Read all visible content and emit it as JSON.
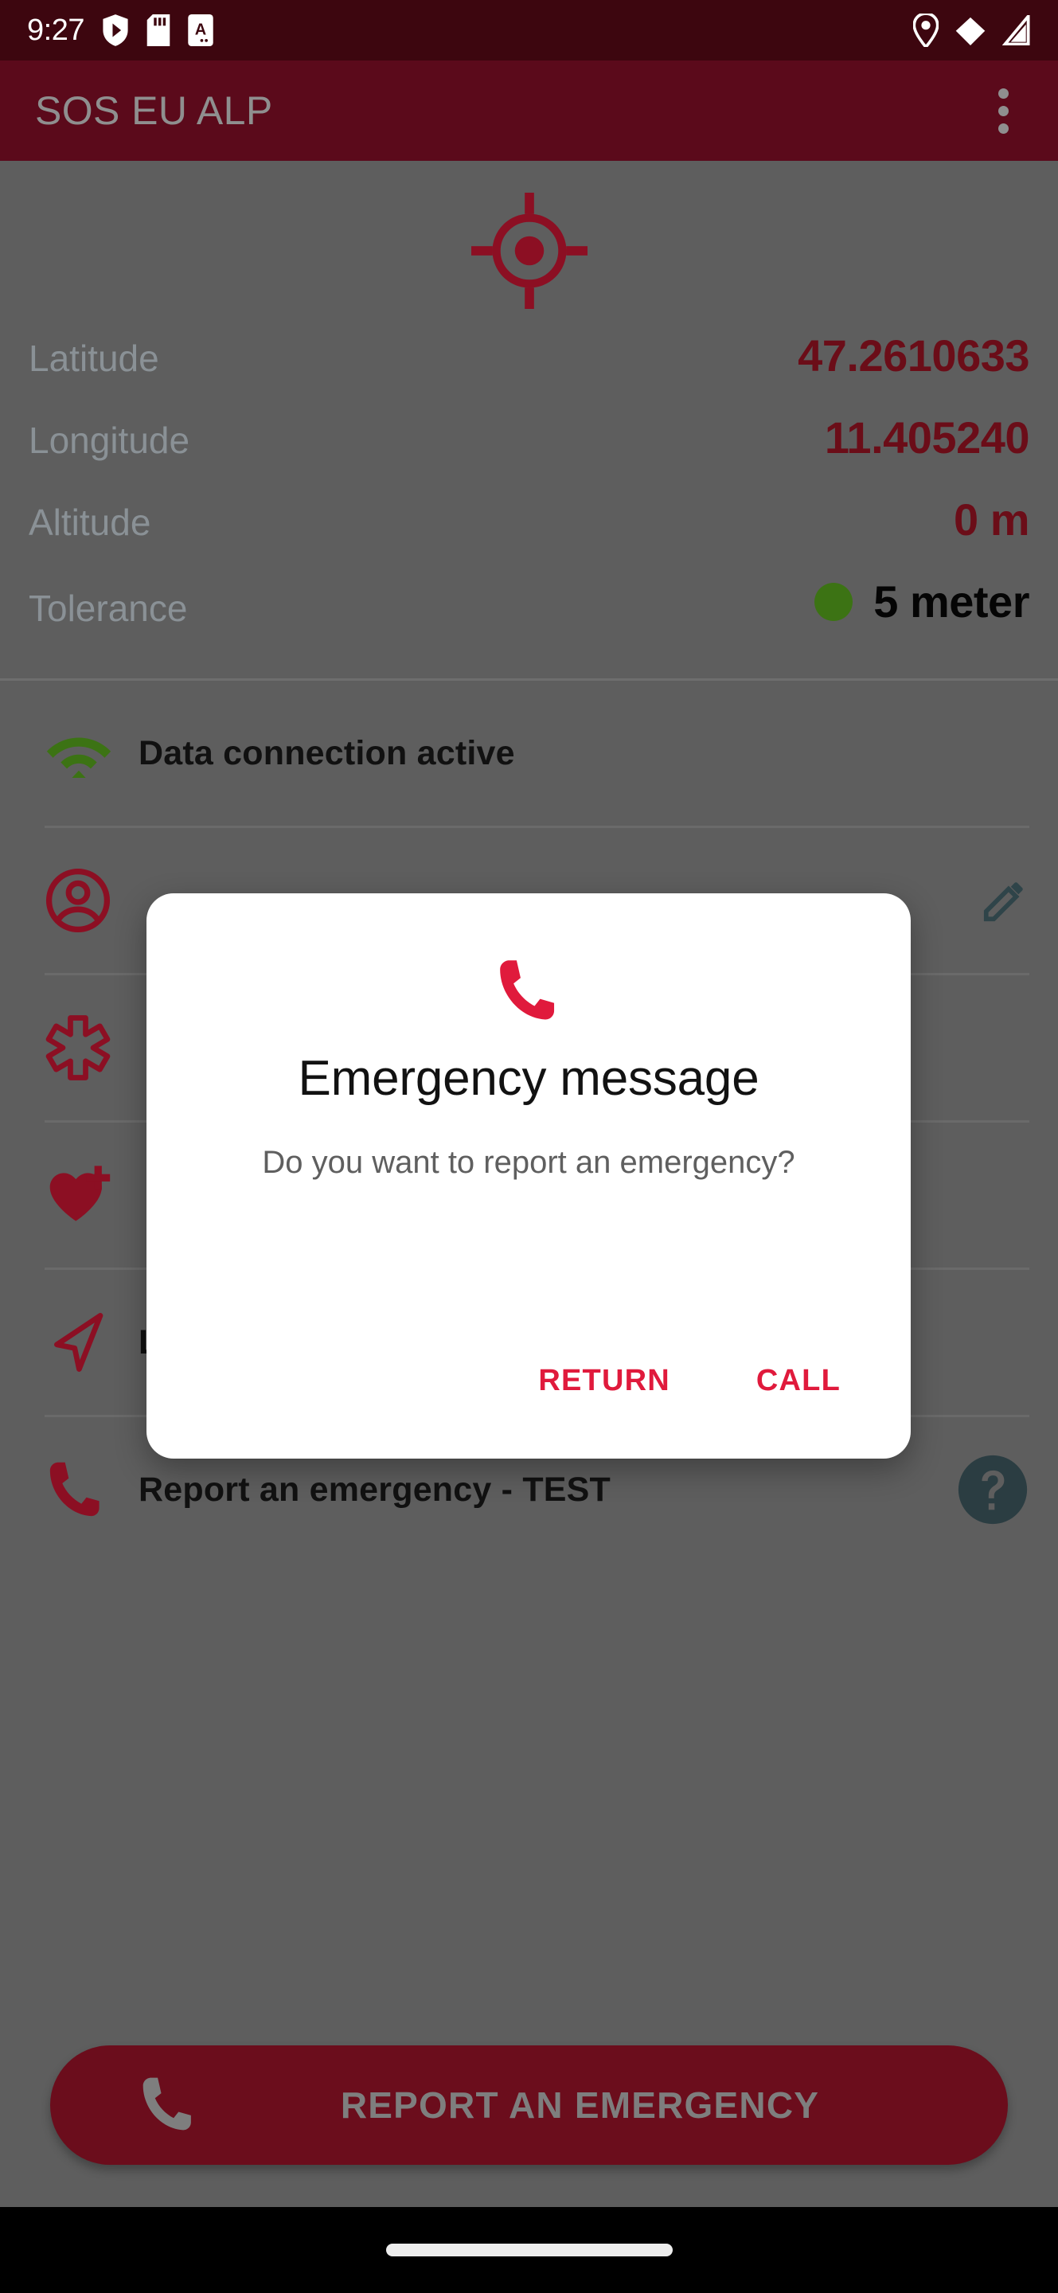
{
  "status_bar": {
    "time": "9:27",
    "left_icons": [
      "play-protect-shield-icon",
      "sd-card-icon",
      "caps-lock-a-icon"
    ],
    "right_icons": [
      "location-pin-icon",
      "wifi-icon",
      "cellular-signal-icon"
    ],
    "background_color": "#3d060f"
  },
  "app_bar": {
    "title": "SOS EU ALP",
    "overflow_menu_label": "more-options",
    "background_color": "#5b0a1b",
    "title_color": "#8f8f8f"
  },
  "gps": {
    "target_icon": "gps-fixed-icon",
    "accent_color": "#6b0d18",
    "label_color": "#8a9196",
    "rows": [
      {
        "label": "Latitude",
        "value": "47.2610633",
        "has_dot": false
      },
      {
        "label": "Longitude",
        "value": "11.405240",
        "has_dot": false
      },
      {
        "label": "Altitude",
        "value": "0 m",
        "has_dot": false
      },
      {
        "label": "Tolerance",
        "value": "5 meter",
        "has_dot": true,
        "dot_color": "#3c7314"
      }
    ]
  },
  "list": {
    "items": [
      {
        "label": "Data connection active",
        "icon": "wifi-icon",
        "icon_color": "#3c7314",
        "action_icon": null
      },
      {
        "label": "",
        "icon": "account-circle-icon",
        "icon_color": "#8c0f23",
        "action_icon": "edit-pencil-icon"
      },
      {
        "label": "",
        "icon": "medical-star-icon",
        "icon_color": "#8c0f23",
        "action_icon": null
      },
      {
        "label": "",
        "icon": "heart-plus-icon",
        "icon_color": "#8c0f23",
        "action_icon": null
      },
      {
        "label": "Location History",
        "icon": "navigation-arrow-icon",
        "icon_color": "#8c0f23",
        "action_icon": null
      },
      {
        "label": "Report an emergency - TEST",
        "icon": "phone-icon",
        "icon_color": "#8c0f23",
        "action_icon": "help-circle-icon"
      }
    ]
  },
  "cta": {
    "label": "REPORT AN EMERGENCY",
    "icon": "phone-icon",
    "background_color": "#6b0d1c",
    "label_color": "#7e7e7e"
  },
  "dialog": {
    "icon": "phone-call-icon",
    "icon_color": "#e01a3c",
    "title": "Emergency message",
    "message": "Do you want to report an emergency?",
    "return_label": "RETURN",
    "call_label": "CALL",
    "button_color": "#e01a3c"
  },
  "nav_bar": {
    "gesture_pill": "home-gesture-pill"
  }
}
